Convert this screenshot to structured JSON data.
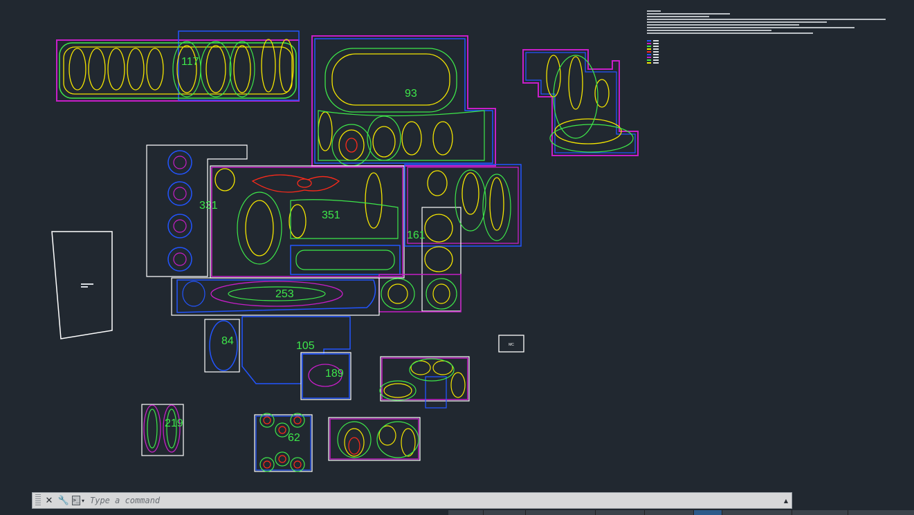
{
  "command_line": {
    "placeholder": "Type a command",
    "close_label": "✕",
    "customize_label": "🔧",
    "history_label": "▲",
    "prompt_label": ">_",
    "prompt_arrow": "▾"
  },
  "room_labels": [
    "117",
    "93",
    "331",
    "351",
    "161",
    "253",
    "84",
    "105",
    "189",
    "219",
    "62",
    "MC"
  ],
  "colors": {
    "background": "#212830",
    "contour_yellow": "#f5e600",
    "contour_green": "#3ee84a",
    "contour_magenta": "#c81ec8",
    "contour_blue": "#2255ff",
    "contour_red": "#ff2a1a",
    "room_outline": "#ffffff",
    "label_green": "#3ee84a"
  }
}
